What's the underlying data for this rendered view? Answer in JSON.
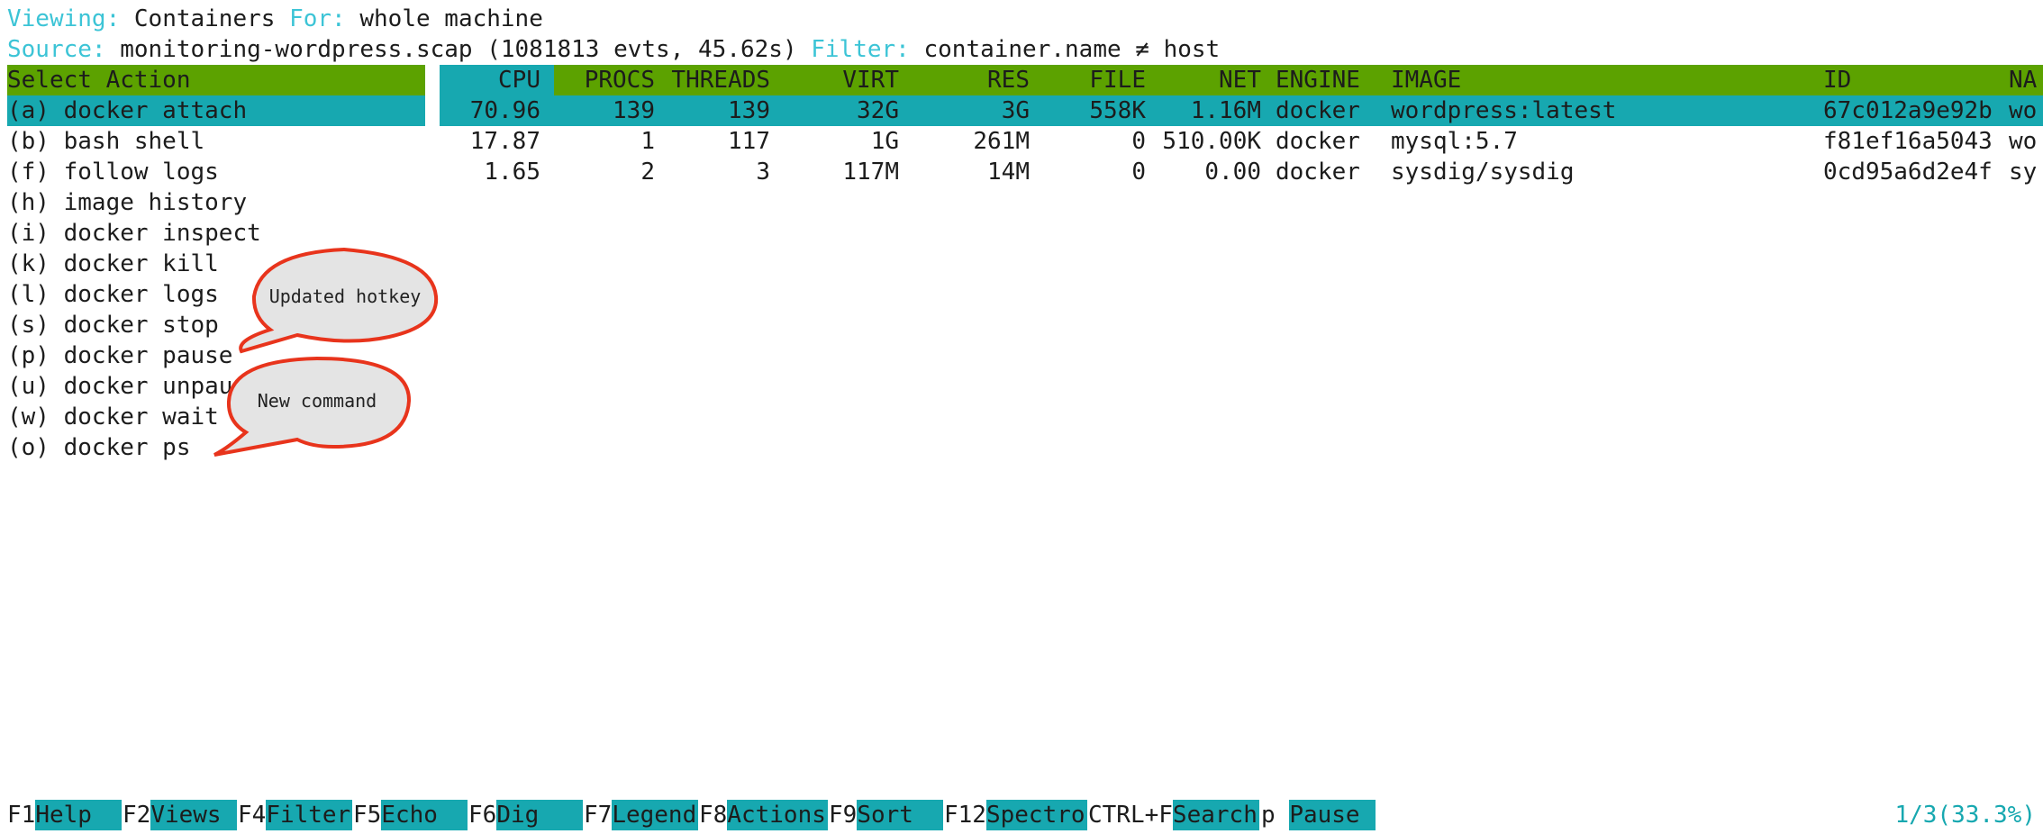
{
  "header": {
    "viewing_label": "Viewing:",
    "viewing_value": "Containers",
    "for_label": "For:",
    "for_value": "whole machine",
    "source_label": "Source:",
    "source_value": "monitoring-wordpress.scap (1081813 evts, 45.62s)",
    "filter_label": "Filter:",
    "filter_value": "container.name ≠ host"
  },
  "actions": {
    "title": "Select Action",
    "items": [
      "(a) docker attach",
      "(b) bash shell",
      "(f) follow logs",
      "(h) image history",
      "(i) docker inspect",
      "(k) docker kill",
      "(l) docker logs",
      "(s) docker stop",
      "(p) docker pause",
      "(u) docker unpause",
      "(w) docker wait",
      "(o) docker ps"
    ]
  },
  "table": {
    "columns": [
      "CPU",
      "PROCS",
      "THREADS",
      "VIRT",
      "RES",
      "FILE",
      "NET",
      "ENGINE",
      "IMAGE",
      "ID",
      "NA"
    ],
    "rows": [
      [
        "70.96",
        "139",
        "139",
        "32G",
        "3G",
        "558K",
        "1.16M",
        "docker",
        "wordpress:latest",
        "67c012a9e92b",
        "wo"
      ],
      [
        "17.87",
        "1",
        "117",
        "1G",
        "261M",
        "0",
        "510.00K",
        "docker",
        "mysql:5.7",
        "f81ef16a5043",
        "wo"
      ],
      [
        "1.65",
        "2",
        "3",
        "117M",
        "14M",
        "0",
        "0.00",
        "docker",
        "sysdig/sysdig",
        "0cd95a6d2e4f",
        "sy"
      ]
    ]
  },
  "callouts": {
    "updated": "Updated hotkey",
    "new": "New command"
  },
  "footer": {
    "keys": [
      {
        "key": "F1",
        "label": "Help"
      },
      {
        "key": "F2",
        "label": "Views"
      },
      {
        "key": "F4",
        "label": "Filter"
      },
      {
        "key": "F5",
        "label": "Echo"
      },
      {
        "key": "F6",
        "label": "Dig"
      },
      {
        "key": "F7",
        "label": "Legend"
      },
      {
        "key": "F8",
        "label": "Actions"
      },
      {
        "key": "F9",
        "label": "Sort"
      },
      {
        "key": "F12",
        "label": "Spectro"
      },
      {
        "key": "CTRL+F",
        "label": "Search"
      },
      {
        "key": "p",
        "label": "Pause"
      }
    ],
    "position": "1/3(33.3%)"
  },
  "colors": {
    "label_cyan": "#3cc4d6",
    "header_green": "#5ca200",
    "highlight_teal": "#17a8b0",
    "callout_red": "#e8341c"
  }
}
